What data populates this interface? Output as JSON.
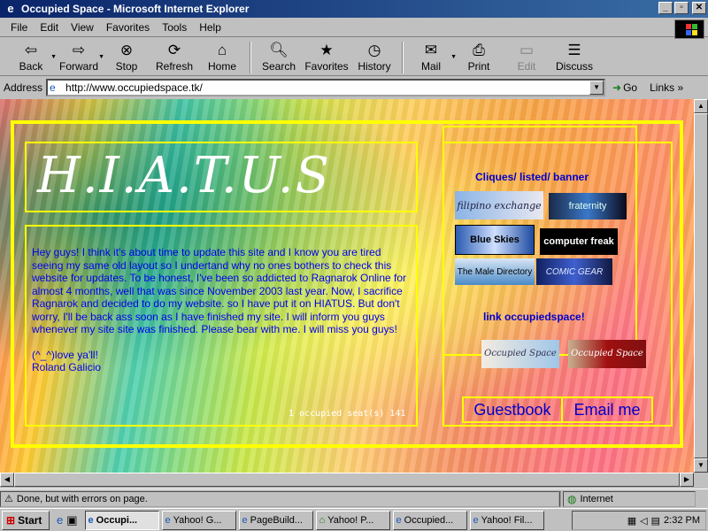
{
  "window": {
    "title": "Occupied Space - Microsoft Internet Explorer"
  },
  "menu": [
    "File",
    "Edit",
    "View",
    "Favorites",
    "Tools",
    "Help"
  ],
  "toolbar": [
    {
      "label": "Back",
      "icon": "back-arrow-icon"
    },
    {
      "label": "Forward",
      "icon": "forward-arrow-icon"
    },
    {
      "label": "Stop",
      "icon": "stop-icon"
    },
    {
      "label": "Refresh",
      "icon": "refresh-icon"
    },
    {
      "label": "Home",
      "icon": "home-icon"
    },
    {
      "label": "Search",
      "icon": "search-icon"
    },
    {
      "label": "Favorites",
      "icon": "favorites-icon"
    },
    {
      "label": "History",
      "icon": "history-icon"
    },
    {
      "label": "Mail",
      "icon": "mail-icon"
    },
    {
      "label": "Print",
      "icon": "print-icon"
    },
    {
      "label": "Edit",
      "icon": "edit-icon"
    },
    {
      "label": "Discuss",
      "icon": "discuss-icon"
    }
  ],
  "address": {
    "label": "Address",
    "url": "http://www.occupiedspace.tk/",
    "go": "Go",
    "links": "Links"
  },
  "page": {
    "title": "H.I.A.T.U.S",
    "body": "Hey guys! I think it's about time to update this site and I know you are tired seeing my same old layout so I undertand why no ones bothers to check this website for updates. To be honest, I've been so addicted to Ragnarok Online for almost 4 months, well that was since November 2003 last year. Now, I sacrifice Ragnarok and decided to do my website. so I have put it on HIATUS. But don't worry, I'll be back ass soon as I have finished my site. I will inform you guys whenever my site site was finished. Please bear with me. I will miss you guys!",
    "signoff1": "(^_^)love ya'll!",
    "signoff2": "Roland Galicio",
    "counter": "1 occupied seat(s) 141",
    "cliques_heading": "Cliques/ listed/ banner",
    "badges": [
      "filipino exchange",
      "fraternity",
      "Blue Skies",
      "computer freak",
      "The Male Directory",
      "COMIC GEAR"
    ],
    "link_heading": "link occupiedspace!",
    "link_badges": [
      "Occupied Space",
      "Occupied Space"
    ],
    "guestbook": "Guestbook",
    "email": "Email me"
  },
  "status": {
    "text": "Done, but with errors on page.",
    "zone": "Internet"
  },
  "taskbar": {
    "start": "Start",
    "tasks": [
      "Occupi...",
      "Yahoo! G...",
      "PageBuild...",
      "Yahoo! P...",
      "Occupied...",
      "Yahoo! Fil..."
    ],
    "clock": "2:32 PM"
  }
}
